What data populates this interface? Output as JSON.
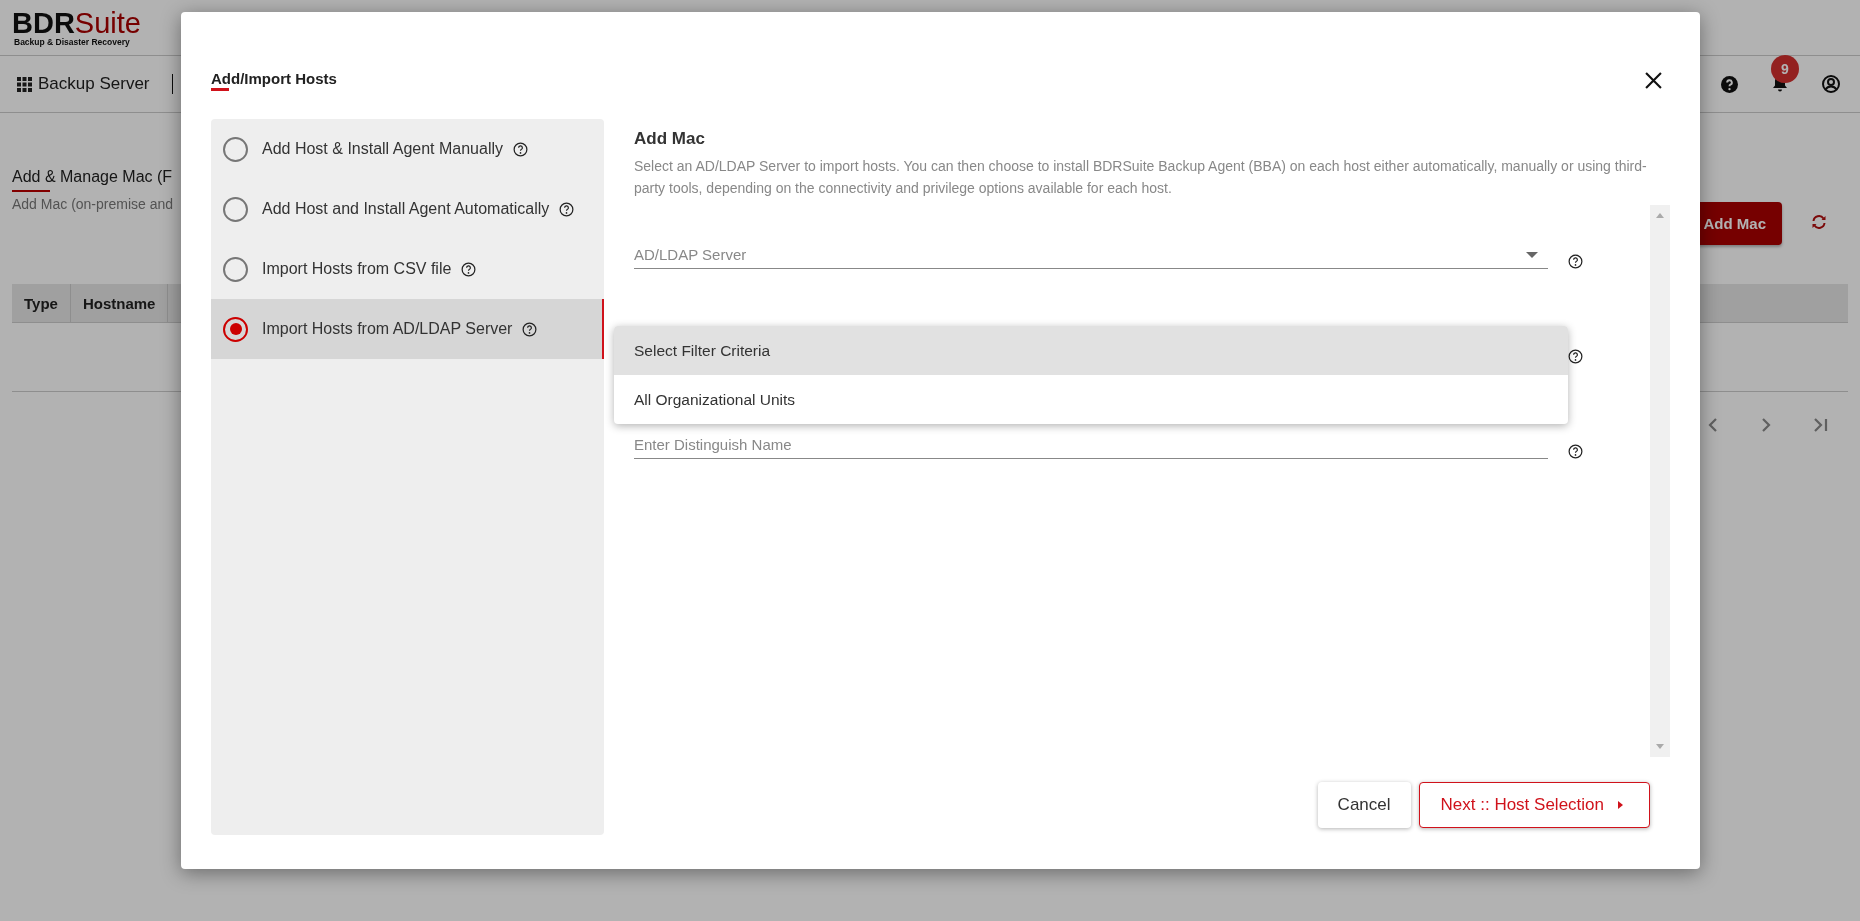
{
  "app": {
    "logo": {
      "brand_dark": "BDR",
      "brand_accent": "Suite",
      "tagline": "Backup & Disaster Recovery"
    },
    "nav": {
      "server": "Backup Server",
      "notification_count": "9"
    },
    "page": {
      "title": "Add & Manage Mac (F",
      "subtitle": "Add Mac (on-premise and",
      "add_button": "Add Mac",
      "table": {
        "columns": [
          "Type",
          "Hostname"
        ]
      }
    }
  },
  "dialog": {
    "title": "Add/Import Hosts",
    "options": [
      {
        "label": "Add Host & Install Agent Manually",
        "selected": false
      },
      {
        "label": "Add Host and Install Agent Automatically",
        "selected": false
      },
      {
        "label": "Import Hosts from CSV file",
        "selected": false
      },
      {
        "label": "Import Hosts from AD/LDAP Server",
        "selected": true
      }
    ],
    "content": {
      "heading": "Add Mac",
      "description": "Select an AD/LDAP Server to import hosts. You can then choose to install BDRSuite Backup Agent (BBA) on each host either automatically, manually or using third-party tools, depending on the connectivity and privilege options available for each host.",
      "fields": [
        {
          "kind": "select",
          "placeholder": "AD/LDAP Server"
        },
        {
          "kind": "menu"
        },
        {
          "kind": "text",
          "placeholder": "Enter Distinguish Name"
        }
      ],
      "dropdown": {
        "options": [
          {
            "label": "Select Filter Criteria",
            "selected": true
          },
          {
            "label": "All Organizational Units",
            "selected": false
          }
        ]
      }
    },
    "buttons": [
      {
        "label": "Cancel",
        "kind": "secondary"
      },
      {
        "label": "Next :: Host Selection",
        "kind": "primary"
      }
    ]
  }
}
